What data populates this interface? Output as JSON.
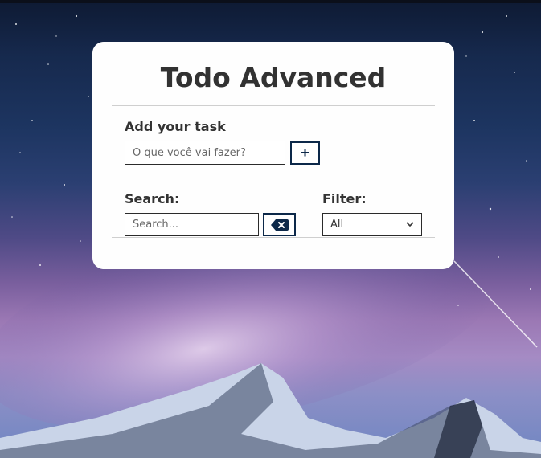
{
  "app": {
    "title": "Todo Advanced"
  },
  "add": {
    "label": "Add your task",
    "placeholder": "O que você vai fazer?",
    "button_label": "+"
  },
  "search": {
    "label": "Search:",
    "placeholder": "Search...",
    "clear_icon": "backspace-icon"
  },
  "filter": {
    "label": "Filter:",
    "selected": "All",
    "options": [
      "All"
    ]
  },
  "colors": {
    "accent": "#0c2849",
    "card_bg": "#fefefe",
    "title": "#323232"
  }
}
